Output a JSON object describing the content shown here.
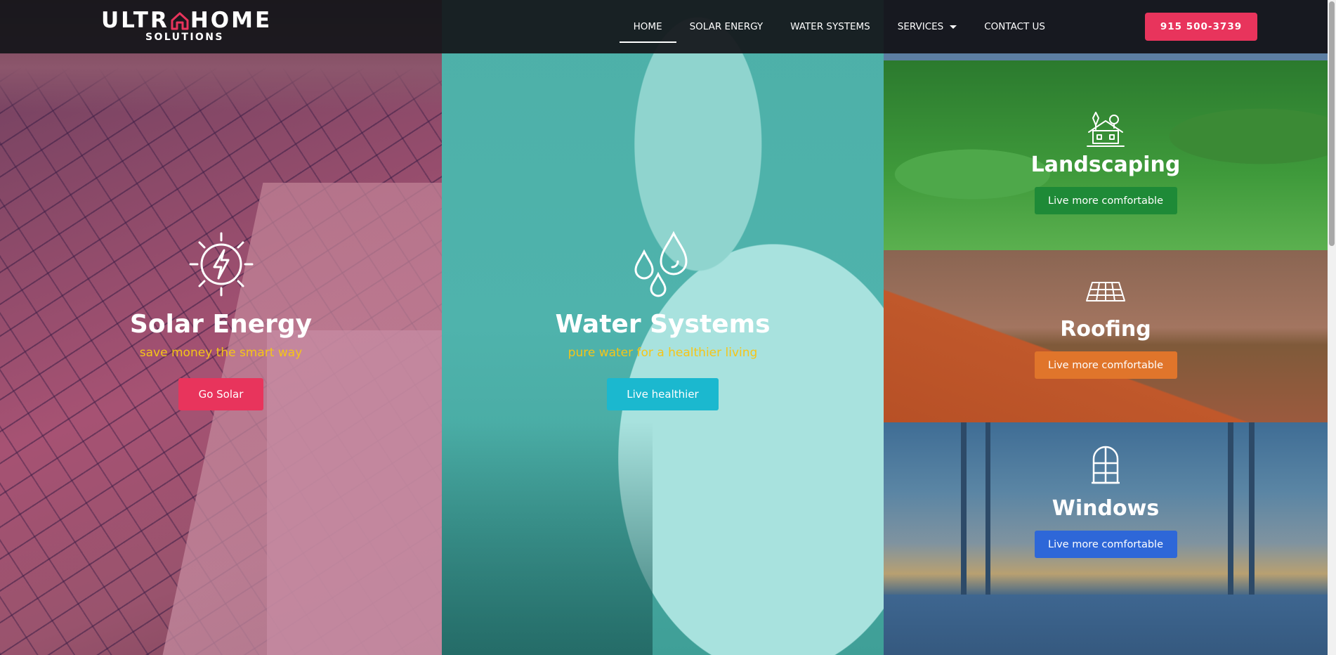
{
  "header": {
    "logo": {
      "top": "ULTR",
      "top_end": "HOME",
      "bottom": "SOLUTIONS"
    },
    "nav": [
      {
        "label": "HOME",
        "active": true
      },
      {
        "label": "SOLAR ENERGY"
      },
      {
        "label": "WATER SYSTEMS"
      },
      {
        "label": "SERVICES",
        "has_dropdown": true
      },
      {
        "label": "CONTACT US"
      }
    ],
    "phone": "915 500-3739"
  },
  "solar": {
    "icon": "sun-bolt-icon",
    "title": "Solar Energy",
    "subtitle": "save money the smart way",
    "button": "Go Solar"
  },
  "water": {
    "icon": "water-drops-icon",
    "title": "Water Systems",
    "subtitle": "pure water for a healthier living",
    "button": "Live healthier"
  },
  "tiles": {
    "landscaping": {
      "icon": "house-trees-icon",
      "title": "Landscaping",
      "button": "Live more comfortable"
    },
    "roofing": {
      "icon": "roof-tiles-icon",
      "title": "Roofing",
      "button": "Live more comfortable"
    },
    "windows": {
      "icon": "arched-window-icon",
      "title": "Windows",
      "button": "Live more comfortable"
    }
  },
  "colors": {
    "accent_pink": "#e8345c",
    "accent_cyan": "#1bb8cf",
    "accent_green": "#1e8a37",
    "accent_orange": "#e0752b",
    "accent_blue": "#2e67d8",
    "subtitle_yellow": "#f5c518"
  }
}
